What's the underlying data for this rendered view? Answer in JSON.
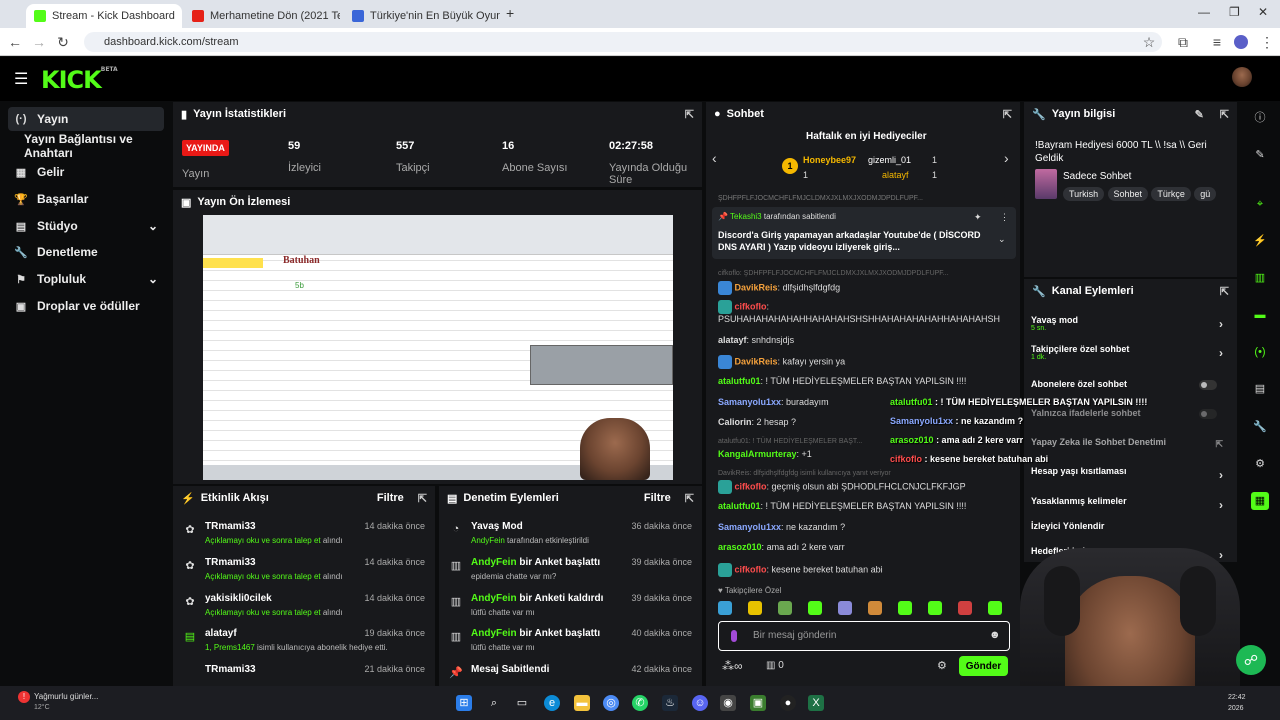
{
  "browser": {
    "tabs": [
      {
        "title": "Stream - Kick Dashboard",
        "active": true
      },
      {
        "title": "Merhametine Dön (2021 Te"
      },
      {
        "title": "Türkiye'nin En Büyük Oyuncu D"
      }
    ],
    "new_tab": "+",
    "url": "dashboard.kick.com/stream"
  },
  "header": {
    "logo": "KICK",
    "beta": "BETA"
  },
  "sidebar": {
    "items": [
      {
        "label": "Yayın",
        "icon": "(·)",
        "active": true
      },
      {
        "label": "Yayın Bağlantısı ve Anahtarı",
        "icon": ""
      },
      {
        "label": "Gelir",
        "icon": "▦"
      },
      {
        "label": "Başarılar",
        "icon": "🏆"
      },
      {
        "label": "Stüdyo",
        "icon": "▤",
        "chevron": "⌄"
      },
      {
        "label": "Denetleme",
        "icon": "🔧"
      },
      {
        "label": "Topluluk",
        "icon": "⚑",
        "chevron": "⌄"
      },
      {
        "label": "Droplar ve ödüller",
        "icon": "▣"
      }
    ]
  },
  "stats": {
    "title": "Yayın İstatistikleri",
    "live_badge": "YAYINDA",
    "live_label": "Yayın",
    "viewers": {
      "value": "59",
      "label": "İzleyici"
    },
    "followers": {
      "value": "557",
      "label": "Takipçi"
    },
    "subs": {
      "value": "16",
      "label": "Abone Sayısı"
    },
    "uptime": {
      "value": "02:27:58",
      "label": "Yayında Olduğu Süre"
    }
  },
  "preview": {
    "title": "Yayın Ön İzlemesi",
    "name_overlay": "Batuhan"
  },
  "activity": {
    "title": "Etkinlik Akışı",
    "filter": "Filtre",
    "items": [
      {
        "user": "TRmami33",
        "action": "Açıklamayı oku ve sonra talep et",
        "suffix": "alındı",
        "time": "14 dakika önce"
      },
      {
        "user": "TRmami33",
        "action": "Açıklamayı oku ve sonra talep et",
        "suffix": "alındı",
        "time": "14 dakika önce"
      },
      {
        "user": "yakisikli0cilek",
        "action": "Açıklamayı oku ve sonra talep et",
        "suffix": "alındı",
        "time": "14 dakika önce"
      },
      {
        "user": "alatayf",
        "action": "1, Prems1467",
        "suffix": "isimli kullanıcıya abonelik hediye etti.",
        "time": "19 dakika önce"
      },
      {
        "user": "TRmami33",
        "action": "",
        "suffix": "",
        "time": "21 dakika önce"
      }
    ]
  },
  "modlog": {
    "title": "Denetim Eylemleri",
    "filter": "Filtre",
    "items": [
      {
        "title": "Yavaş Mod",
        "actor": "AndyFein",
        "detail": "tarafından etkinleştirildi",
        "time": "36 dakika önce"
      },
      {
        "title_actor": "AndyFein",
        "title": "bir Anket başlattı",
        "detail": "epidemia chatte var mı?",
        "time": "39 dakika önce"
      },
      {
        "title_actor": "AndyFein",
        "title": "bir Anketi kaldırdı",
        "detail": "lütfü chatte var mı",
        "time": "39 dakika önce"
      },
      {
        "title_actor": "AndyFein",
        "title": "bir Anket başlattı",
        "detail": "lütfü chatte var mı",
        "time": "40 dakika önce"
      },
      {
        "title": "Mesaj Sabitlendi",
        "detail": "",
        "time": "42 dakika önce"
      }
    ]
  },
  "chat": {
    "title": "Sohbet",
    "gifters_title": "Haftalık en iyi Hediyeciler",
    "gifters": [
      {
        "rank": "1",
        "name": "Honeybee97",
        "count": "1"
      },
      {
        "name": "gizemli_01",
        "count": "1"
      },
      {
        "name": "alatayf",
        "count": "1"
      }
    ],
    "pinned": {
      "by": "Tekashi3",
      "by_suffix": "tarafından sabitlendi",
      "text": "Discord'a Giriş yapamayan arkadaşlar Youtube'de ( DİSCORD DNS AYARI ) Yazıp videoyu izliyerek giriş..."
    },
    "truncated_top": "ŞDHFPFLFJOCMCHFLFMJCLDMXJXLMXJXODMJDPDLFUPF...",
    "reply_context_1": "cifkoflo: ŞDHFPFLFJOCMCHFLFMJCLDMXJXLMXJXODMJDPDLFUPF...",
    "messages": [
      {
        "user": "DavikReis",
        "text": "dlfşidhşlfdgfdg",
        "color": "o"
      },
      {
        "user": "cifkoflo",
        "text": "PSUHAHAHAHAHAHHAHAHAHSHSHHAHAHAHAHAHHAHAHAHSH",
        "color": "r"
      },
      {
        "user": "alatayf",
        "text": "snhdnsjdjs",
        "color": "w"
      },
      {
        "user": "DavikReis",
        "text": "kafayı yersin ya",
        "color": "o"
      },
      {
        "user": "atalutfu01",
        "text": "! TÜM HEDİYELEŞMELER BAŞTAN YAPILSIN !!!!",
        "color": "g"
      },
      {
        "user": "Samanyolu1xx",
        "text": "buradayım",
        "color": "b"
      },
      {
        "user": "Caliorin",
        "text": "2 hesap ?",
        "color": "w"
      },
      {
        "user": "KangalArmurteray",
        "text": "+1",
        "color": "g"
      },
      {
        "user": "cifkoflo",
        "text": "geçmiş olsun abi ŞDHODLFHCLCNJCLFKFJGP",
        "color": "r"
      },
      {
        "user": "atalutfu01",
        "text": "! TÜM HEDİYELEŞMELER BAŞTAN YAPILSIN !!!!",
        "color": "g"
      },
      {
        "user": "Samanyolu1xx",
        "text": "ne kazandım ?",
        "color": "b"
      },
      {
        "user": "arasoz010",
        "text": "ama adı 2 kere varr",
        "color": "g"
      },
      {
        "user": "cifkoflo",
        "text": "kesene bereket batuhan abi",
        "color": "r"
      }
    ],
    "reply_context_2": "atalutfu01: ! TÜM HEDİYELEŞMELER BAŞT...",
    "reply_context_3": "DavikReis: dlfşidhşlfdgfdg isimli kullanıcıya yanıt veriyor",
    "followers_only": "Takipçilere Özel",
    "input_placeholder": "Bir mesaj gönderin",
    "points": "0",
    "send": "Gönder"
  },
  "overlay_chat": [
    {
      "user": "atalutfu01",
      "text": ": ! TÜM HEDİYELEŞMELER BAŞTAN YAPILSIN !!!!"
    },
    {
      "user": "Samanyolu1xx",
      "text": ": ne kazandım ?"
    },
    {
      "user": "arasoz010",
      "text": ": ama adı 2 kere varr"
    },
    {
      "user": "cifkoflo",
      "text": ": kesene bereket batuhan abi"
    }
  ],
  "stream_info": {
    "title": "Yayın bilgisi",
    "stream_title": "!Bayram Hediyesi 6000 TL \\\\ !sa \\\\ Geri Geldik",
    "category": "Sadece Sohbet",
    "tags": [
      "Turkish",
      "Sohbet",
      "Türkçe",
      "gü"
    ]
  },
  "channel_actions": {
    "title": "Kanal Eylemleri",
    "rows": [
      {
        "label": "Yavaş mod",
        "sub": "5 sn.",
        "type": "chevron"
      },
      {
        "label": "Takipçilere özel sohbet",
        "sub": "1 dk.",
        "type": "chevron"
      },
      {
        "label": "Abonelere özel sohbet",
        "type": "toggle"
      },
      {
        "label": "Yalnızca ifadelerle sohbet",
        "type": "toggle"
      },
      {
        "label": "Yapay Zeka ile Sohbet Denetimi",
        "type": "link"
      },
      {
        "label": "Hesap yaşı kısıtlaması",
        "type": "chevron"
      },
      {
        "label": "Yasaklanmış kelimeler",
        "type": "chevron"
      },
      {
        "label": "İzleyici Yönlendir",
        "type": "none"
      },
      {
        "label": "Hedefleri bel",
        "type": "chevron"
      }
    ]
  },
  "taskbar": {
    "weather": "Yağmurlu günler...",
    "temp": "12°C",
    "time": "22:42",
    "date": "2026"
  },
  "colors": {
    "accent": "#53fc18",
    "live": "#e91916",
    "panel": "#18191c"
  }
}
